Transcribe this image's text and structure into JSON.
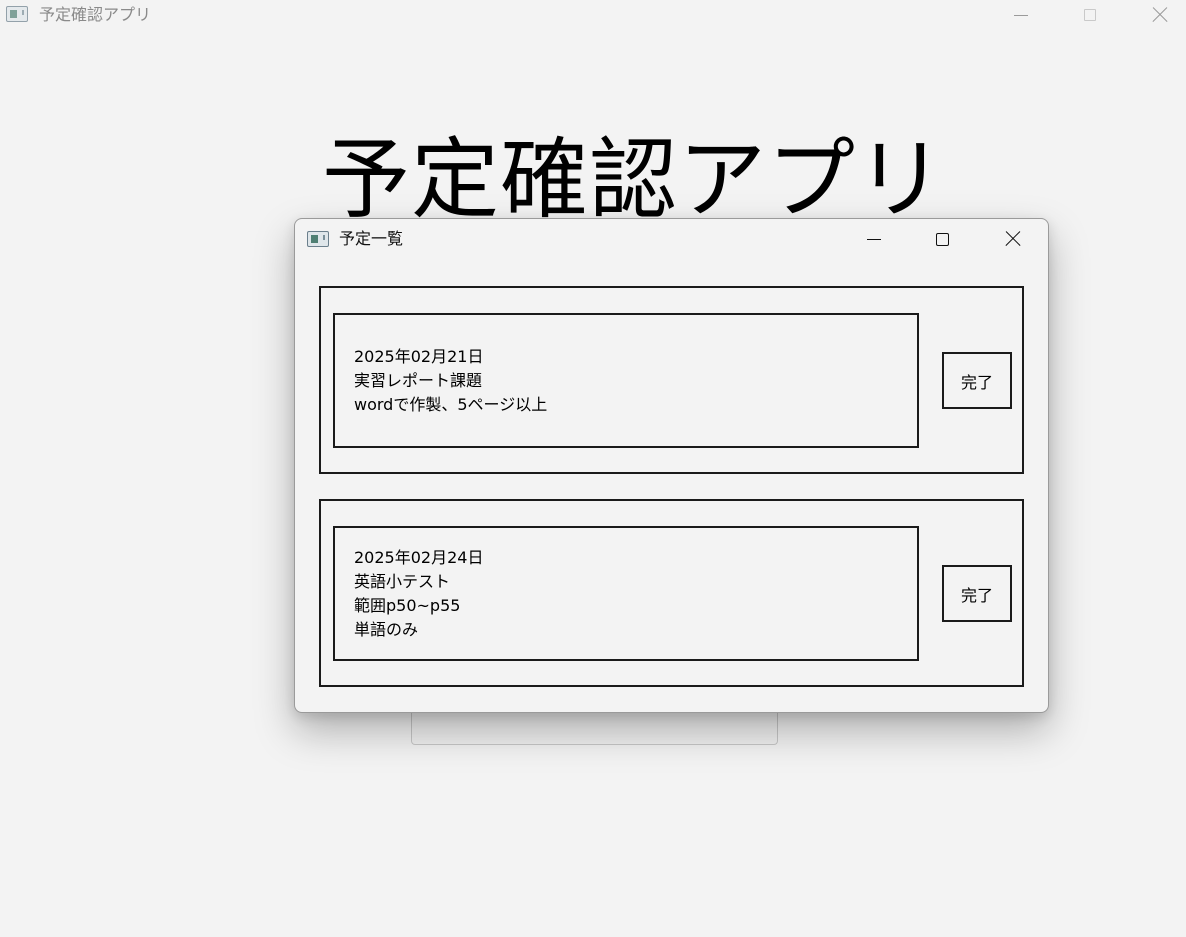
{
  "main_window": {
    "title": "予定確認アプリ",
    "heading": "予定確認アプリ"
  },
  "dialog": {
    "title": "予定一覧",
    "items": [
      {
        "date": "2025年02月21日",
        "lines": [
          "実習レポート課題",
          "wordで作製、5ページ以上"
        ],
        "button_label": "完了"
      },
      {
        "date": "2025年02月24日",
        "lines": [
          "英語小テスト",
          "範囲p50~p55",
          "単語のみ"
        ],
        "button_label": "完了"
      }
    ]
  },
  "icons": {
    "app": "app-window-icon",
    "minimize": "minimize-icon",
    "maximize": "maximize-icon",
    "close": "close-icon"
  }
}
